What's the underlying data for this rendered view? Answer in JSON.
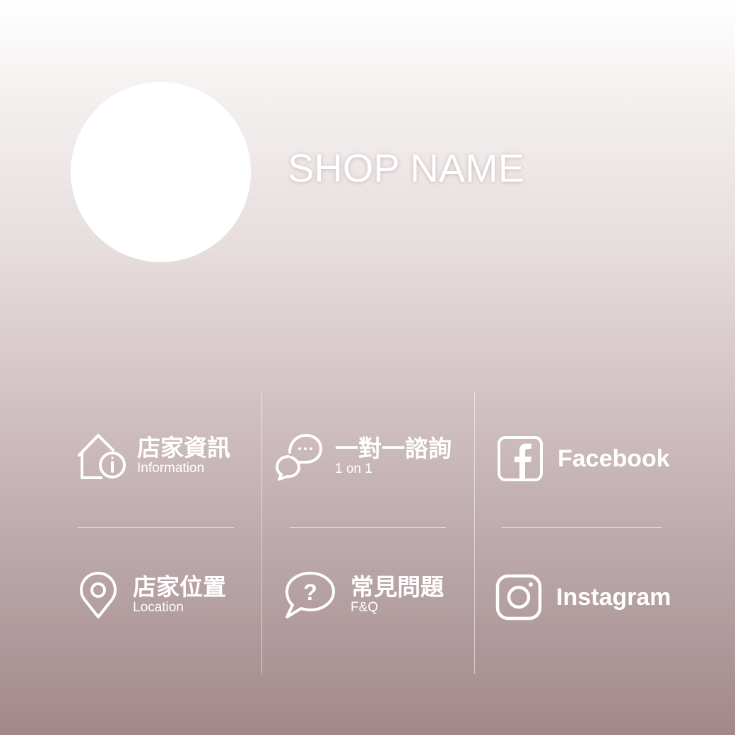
{
  "header": {
    "shop_name": "SHOP NAME"
  },
  "menu": {
    "info": {
      "zh": "店家資訊",
      "en": "Information",
      "icon": "house-info-icon"
    },
    "consult": {
      "zh": "一對一諮詢",
      "en": "1 on 1",
      "icon": "chat-bubbles-icon"
    },
    "facebook": {
      "label": "Facebook",
      "icon": "facebook-icon"
    },
    "location": {
      "zh": "店家位置",
      "en": "Location",
      "icon": "map-pin-icon"
    },
    "faq": {
      "zh": "常見問題",
      "en": "F&Q",
      "icon": "question-bubble-icon"
    },
    "instagram": {
      "label": "Instagram",
      "icon": "instagram-icon"
    }
  },
  "colors": {
    "gradient_top": "#ffffff",
    "gradient_bottom": "#a3888b",
    "foreground": "#ffffff"
  }
}
